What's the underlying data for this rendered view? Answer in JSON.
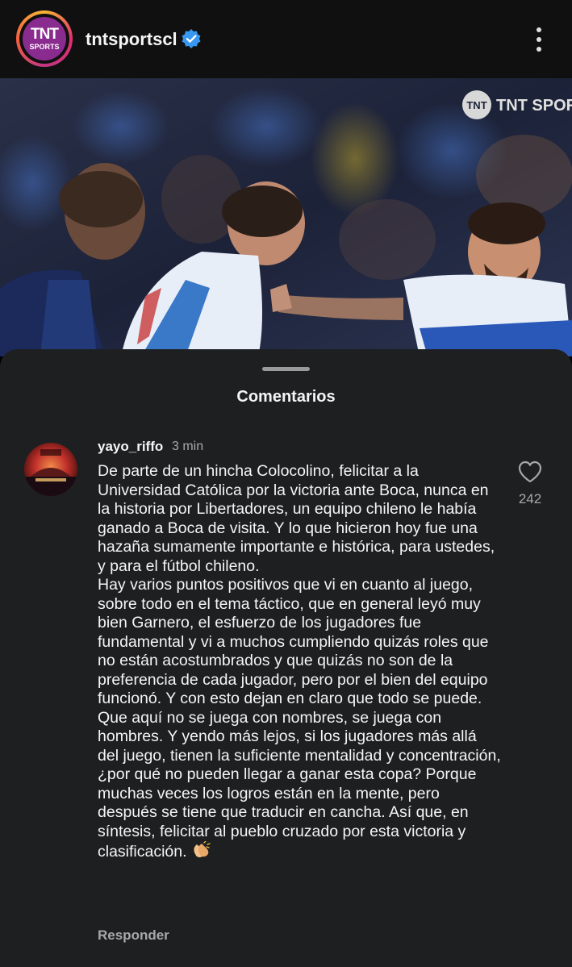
{
  "header": {
    "avatar_logo_text": "TNT",
    "avatar_logo_sub": "SPORTS",
    "username": "tntsportscl",
    "verified_icon": "verified-badge-icon",
    "more_icon": "more-vertical-icon"
  },
  "photo": {
    "watermark": "TNT SPORTS",
    "description_icon": "post-photo"
  },
  "comments_sheet": {
    "title": "Comentarios",
    "comments": [
      {
        "username": "yayo_riffo",
        "time": "3 min",
        "text": "De parte de un hincha Colocolino, felicitar a la Universidad Católica por la victoria ante Boca, nunca en la historia por Libertadores, un equipo chileno le había ganado a Boca de visita. Y lo que hicieron hoy fue una hazaña sumamente importante e histórica, para ustedes, y para el fútbol chileno.\nHay varios puntos positivos que vi en cuanto al juego, sobre todo en el tema táctico, que en general leyó muy bien Garnero, el esfuerzo de los jugadores fue fundamental y vi a muchos cumpliendo quizás roles que no están acostumbrados y que quizás no son de la preferencia de cada jugador, pero por el bien del equipo funcionó. Y con esto dejan en claro que todo se puede. Que aquí no se juega con nombres, se juega con hombres. Y yendo más lejos, si los jugadores más allá del juego, tienen la suficiente mentalidad y concentración, ¿por qué no pueden llegar a ganar esta copa? Porque muchas veces los logros están en la mente, pero después se tiene que traducir en cancha. Así que, en síntesis, felicitar al pueblo cruzado por esta victoria y clasificación.",
        "emoji_icon": "clapping-hands-icon",
        "like_count": "242",
        "reply_label": "Responder"
      }
    ]
  },
  "colors": {
    "header_bg": "#101010",
    "sheet_bg": "#1e1f21",
    "verified_blue": "#3897f0",
    "muted_text": "#a8a8a8"
  }
}
